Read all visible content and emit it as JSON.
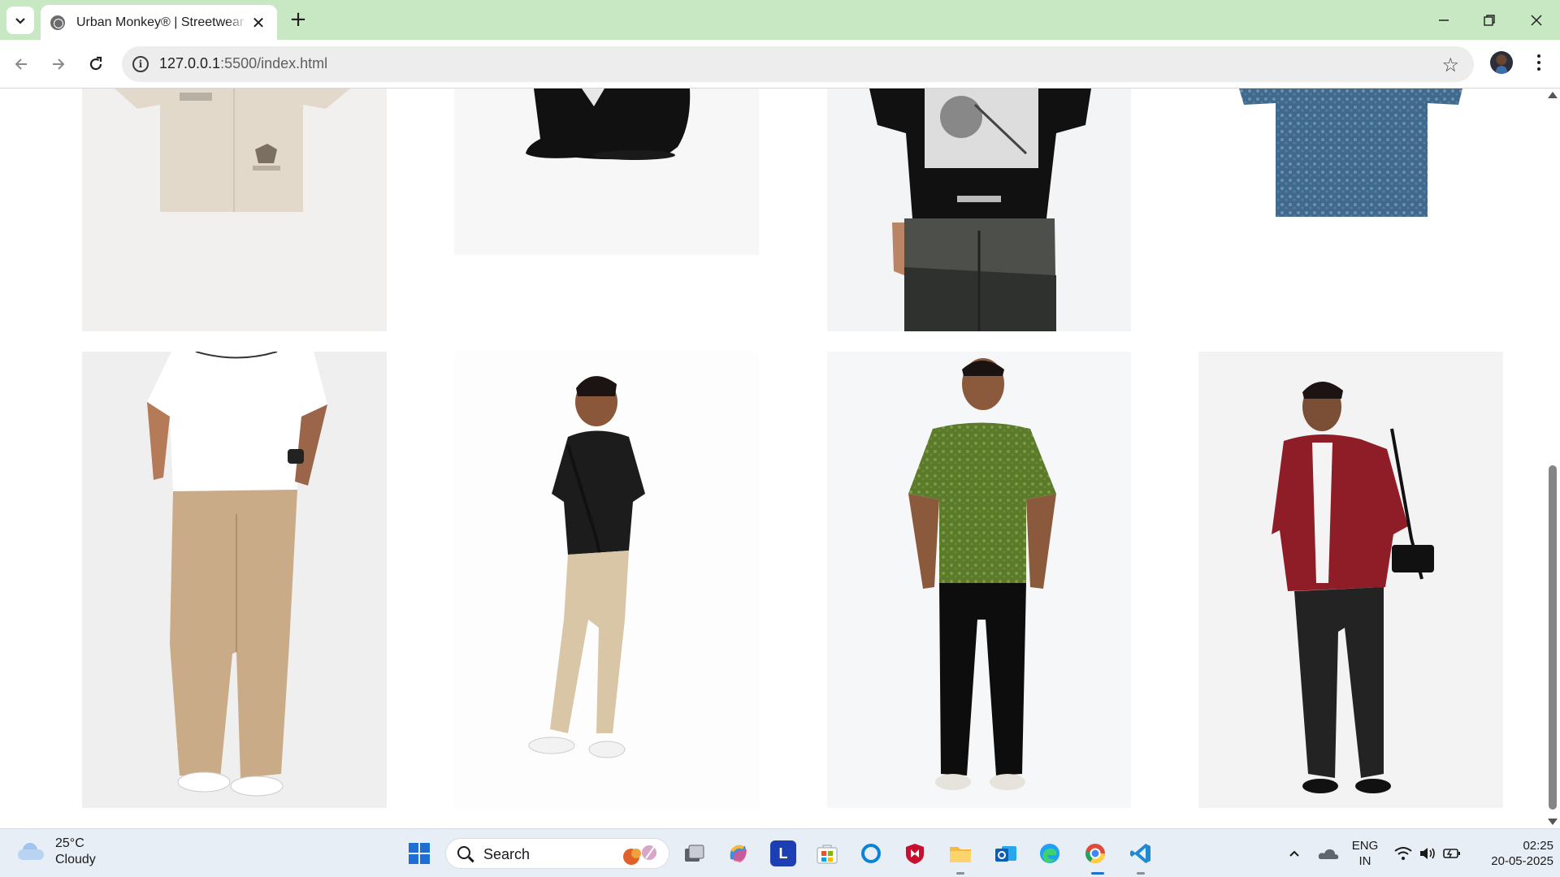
{
  "browser": {
    "tab_title": "Urban Monkey® | Streetwear Clothing",
    "url_host": "127.0.0.1",
    "url_path": ":5500/index.html",
    "accent": "#c7e8c2"
  },
  "products": [
    {
      "name": "beige shirt"
    },
    {
      "name": "black cap"
    },
    {
      "name": "black graphic tee with washed denim"
    },
    {
      "name": "blue acid-wash tee"
    },
    {
      "name": "white tee with beige corduroy pants"
    },
    {
      "name": "black polo with beige pants and sling bag"
    },
    {
      "name": "green acid-wash tee with black trousers"
    },
    {
      "name": "red overshirt with black jeans"
    }
  ],
  "taskbar": {
    "weather_temp": "25°C",
    "weather_desc": "Cloudy",
    "search_label": "Search",
    "l_app_letter": "L",
    "lang_top": "ENG",
    "lang_bottom": "IN",
    "time": "02:25",
    "date": "20-05-2025"
  }
}
